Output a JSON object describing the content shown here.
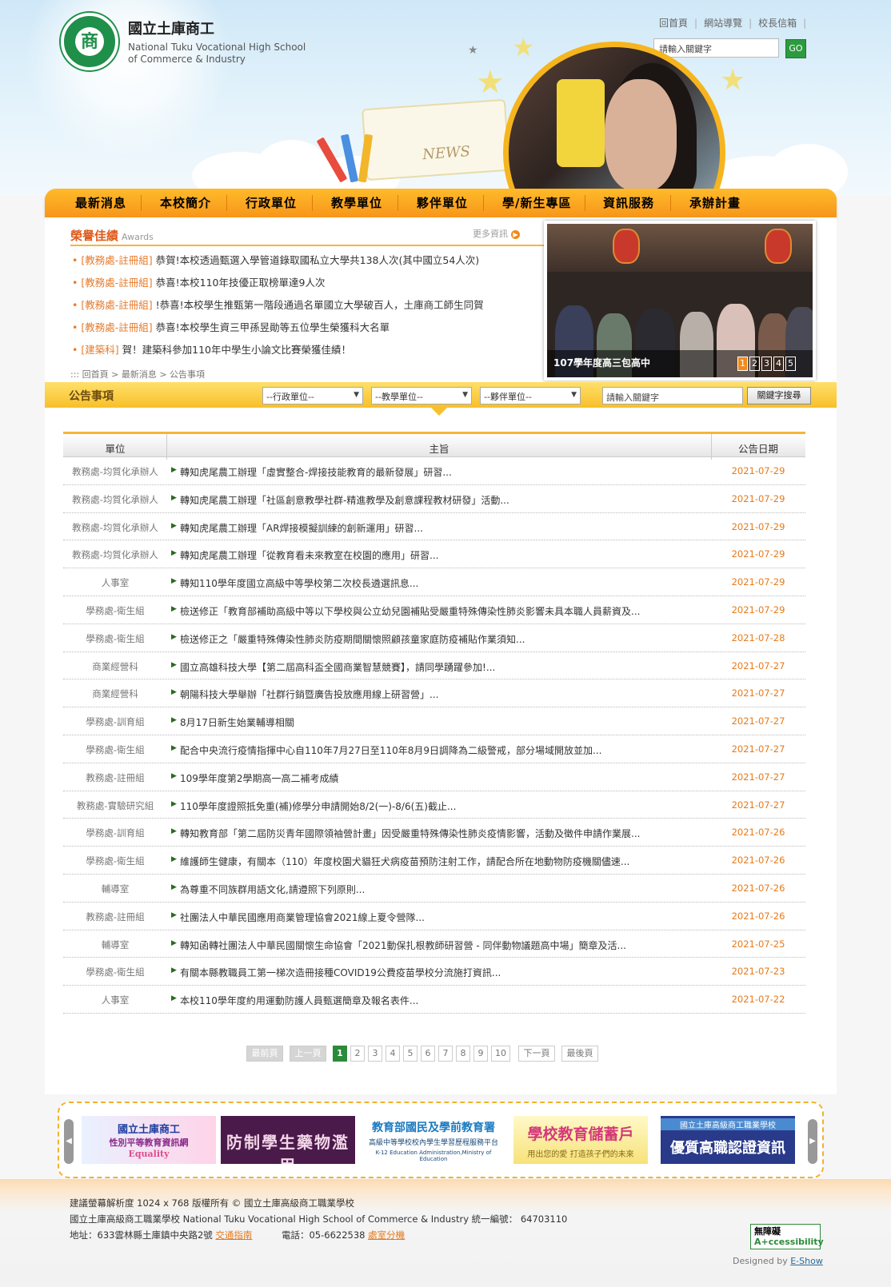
{
  "site": {
    "name_zh": "國立土庫商工",
    "name_en_line1": "National Tuku Vocational High School",
    "name_en_line2": "of Commerce & Industry",
    "logo_char": "商"
  },
  "toplinks": [
    "回首頁",
    "網站導覽",
    "校長信箱"
  ],
  "search": {
    "placeholder": "請輸入關鍵字",
    "button": "GO"
  },
  "header_art": {
    "book_text": "NEWS"
  },
  "nav": [
    "最新消息",
    "本校簡介",
    "行政單位",
    "教學單位",
    "夥伴單位",
    "學/新生專區",
    "資訊服務",
    "承辦計畫"
  ],
  "honors": {
    "title": "榮譽佳績",
    "subtitle": "Awards",
    "more": "更多資訊",
    "items": [
      {
        "tag": "[教務處-註冊組]",
        "text": "恭賀!本校透過甄選入學管道錄取國私立大學共138人次(其中國立54人次)"
      },
      {
        "tag": "[教務處-註冊組]",
        "text": "恭喜!本校110年技優正取榜單達9人次"
      },
      {
        "tag": "[教務處-註冊組]",
        "text": "!恭喜!本校學生推甄第一階段通過名單國立大學破百人，土庫商工師生同賀"
      },
      {
        "tag": "[教務處-註冊組]",
        "text": "恭喜!本校學生資三甲孫昱勛等五位學生榮獲科大名單"
      },
      {
        "tag": "[建築科]",
        "text": "賀！建築科參加110年中學生小論文比賽榮獲佳績！"
      }
    ]
  },
  "breadcrumb": ":::  回首頁 > 最新消息 > 公告事項",
  "slider": {
    "caption": "107學年度高三包高中",
    "pages": [
      "1",
      "2",
      "3",
      "4",
      "5"
    ],
    "active": 1
  },
  "filter": {
    "title": "公告事項",
    "select1": "--行政單位--",
    "select2": "--教學單位--",
    "select3": "--夥伴單位--",
    "keyword_placeholder": "請輸入關鍵字",
    "button": "關鍵字搜尋"
  },
  "table": {
    "headers": [
      "單位",
      "主旨",
      "公告日期"
    ],
    "rows": [
      {
        "unit": "教務處-均質化承辦人",
        "subject": "轉知虎尾農工辦理「虛實整合-焊接技能教育的最新發展」研習...",
        "date": "2021-07-29"
      },
      {
        "unit": "教務處-均質化承辦人",
        "subject": "轉知虎尾農工辦理「社區創意教學社群-精進教學及創意課程教材研發」活動...",
        "date": "2021-07-29"
      },
      {
        "unit": "教務處-均質化承辦人",
        "subject": "轉知虎尾農工辦理「AR焊接模擬訓練的創新運用」研習...",
        "date": "2021-07-29"
      },
      {
        "unit": "教務處-均質化承辦人",
        "subject": "轉知虎尾農工辦理「從教育看未來教室在校園的應用」研習...",
        "date": "2021-07-29"
      },
      {
        "unit": "人事室",
        "subject": "轉知110學年度國立高級中等學校第二次校長遴選訊息...",
        "date": "2021-07-29"
      },
      {
        "unit": "學務處-衛生組",
        "subject": "檢送修正「教育部補助高級中等以下學校與公立幼兒園補貼受嚴重特殊傳染性肺炎影響未具本職人員薪資及...",
        "date": "2021-07-29"
      },
      {
        "unit": "學務處-衛生組",
        "subject": "檢送修正之「嚴重特殊傳染性肺炎防疫期間關懷照顧孩童家庭防疫補貼作業須知...",
        "date": "2021-07-28"
      },
      {
        "unit": "商業經營科",
        "subject": "國立高雄科技大學【第二屆高科盃全國商業智慧競賽】，請同學踴躍參加!...",
        "date": "2021-07-27"
      },
      {
        "unit": "商業經營科",
        "subject": "朝陽科技大學舉辦「社群行銷暨廣告投放應用線上研習營」...",
        "date": "2021-07-27"
      },
      {
        "unit": "學務處-訓育組",
        "subject": "8月17日新生始業輔導相關",
        "date": "2021-07-27"
      },
      {
        "unit": "學務處-衛生組",
        "subject": "配合中央流行疫情指揮中心自110年7月27日至110年8月9日調降為二級警戒，部分場域開放並加...",
        "date": "2021-07-27"
      },
      {
        "unit": "教務處-註冊組",
        "subject": "109學年度第2學期高一高二補考成績",
        "date": "2021-07-27"
      },
      {
        "unit": "教務處-實驗研究組",
        "subject": "110學年度證照抵免重(補)修學分申請開始8/2(一)-8/6(五)截止...",
        "date": "2021-07-27"
      },
      {
        "unit": "學務處-訓育組",
        "subject": "轉知教育部「第二屆防災青年國際領袖營計畫」因受嚴重特殊傳染性肺炎疫情影響，活動及徵件申請作業展...",
        "date": "2021-07-26"
      },
      {
        "unit": "學務處-衛生組",
        "subject": "維護師生健康，有關本（110）年度校園犬貓狂犬病疫苗預防注射工作，請配合所在地動物防疫機關儘速...",
        "date": "2021-07-26"
      },
      {
        "unit": "輔導室",
        "subject": "為尊重不同族群用語文化,請遵照下列原則...",
        "date": "2021-07-26"
      },
      {
        "unit": "教務處-註冊組",
        "subject": "社團法人中華民國應用商業管理協會2021線上夏令營隊...",
        "date": "2021-07-26"
      },
      {
        "unit": "輔導室",
        "subject": "轉知函轉社團法人中華民國關懷生命協會「2021動保扎根教師研習營 - 同伴動物議題高中場」簡章及活...",
        "date": "2021-07-25"
      },
      {
        "unit": "學務處-衛生組",
        "subject": "有關本縣教職員工第一梯次造冊接種COVID19公費疫苗學校分流施打資訊...",
        "date": "2021-07-23"
      },
      {
        "unit": "人事室",
        "subject": "本校110學年度約用運動防護人員甄選簡章及報名表件...",
        "date": "2021-07-22"
      }
    ]
  },
  "pager": {
    "first": "最前頁",
    "prev": "上一頁",
    "pages": [
      "1",
      "2",
      "3",
      "4",
      "5",
      "6",
      "7",
      "8",
      "9",
      "10"
    ],
    "current": "1",
    "next": "下一頁",
    "last": "最後頁"
  },
  "banners": [
    {
      "line1": "國立土庫商工",
      "line2": "性別平等教育資訊網",
      "word": "Equality"
    },
    {
      "line1": "防制學生藥物濫用"
    },
    {
      "line1": "教育部國民及學前教育署",
      "line2": "高級中等學校校內學生學習歷程服務平台",
      "line3": "K-12 Education Administration,Ministry of Education"
    },
    {
      "line1": "學校教育儲蓄戶",
      "line2": "用出您的愛 打造孩子們的未來"
    },
    {
      "line1": "國立土庫高級商工職業學校",
      "line2": "優質高職認證資訊"
    }
  ],
  "footer": {
    "line1": "建議螢幕解析度 1024 x 768      版權所有 © 國立土庫高級商工職業學校",
    "line2": "國立土庫高級商工職業學校 National Tuku Vocational High School of Commerce & Industry      統一編號： 64703110",
    "addr": "地址：633雲林縣土庫鎮中央路2號",
    "traffic": "交通指南",
    "phone": "電話：05-6622538",
    "ext": "處室分機",
    "badge_line1": "無障礙",
    "badge_line2": "A+ccessibility",
    "designed_prefix": "Designed by",
    "designed_by": "E-Show"
  },
  "colors": {
    "accent": "#f7951a",
    "brand_green": "#1f8f4a",
    "date": "#e67a1a"
  }
}
